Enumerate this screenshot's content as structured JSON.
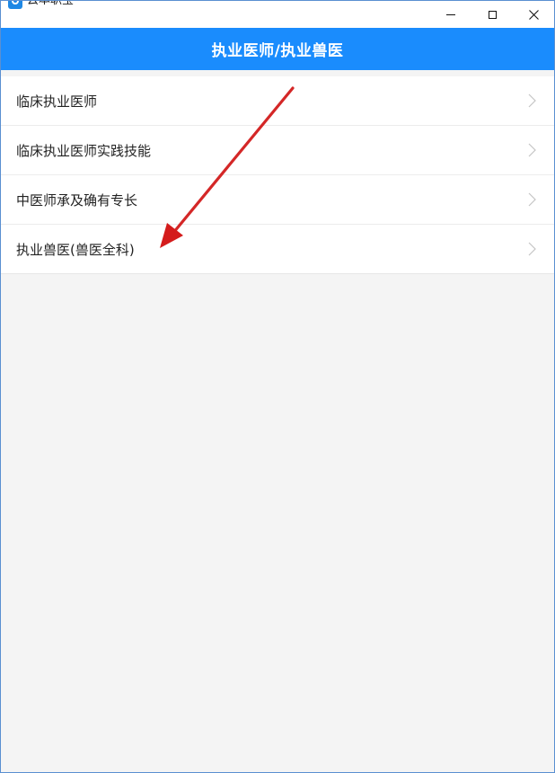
{
  "window": {
    "title": "云本职宝",
    "minimize_icon": "minimize-icon",
    "maximize_icon": "maximize-icon",
    "close_icon": "close-icon"
  },
  "header": {
    "title": "执业医师/执业兽医",
    "background": "#1a8cfd"
  },
  "list": {
    "items": [
      {
        "label": "临床执业医师",
        "icon": "chevron-right-icon"
      },
      {
        "label": "临床执业医师实践技能",
        "icon": "chevron-right-icon"
      },
      {
        "label": "中医师承及确有专长",
        "icon": "chevron-right-icon"
      },
      {
        "label": "执业兽医(兽医全科)",
        "icon": "chevron-right-icon"
      }
    ]
  },
  "annotation": {
    "arrow_color": "#d81e1e",
    "target_item": "执业兽医(兽医全科)"
  }
}
